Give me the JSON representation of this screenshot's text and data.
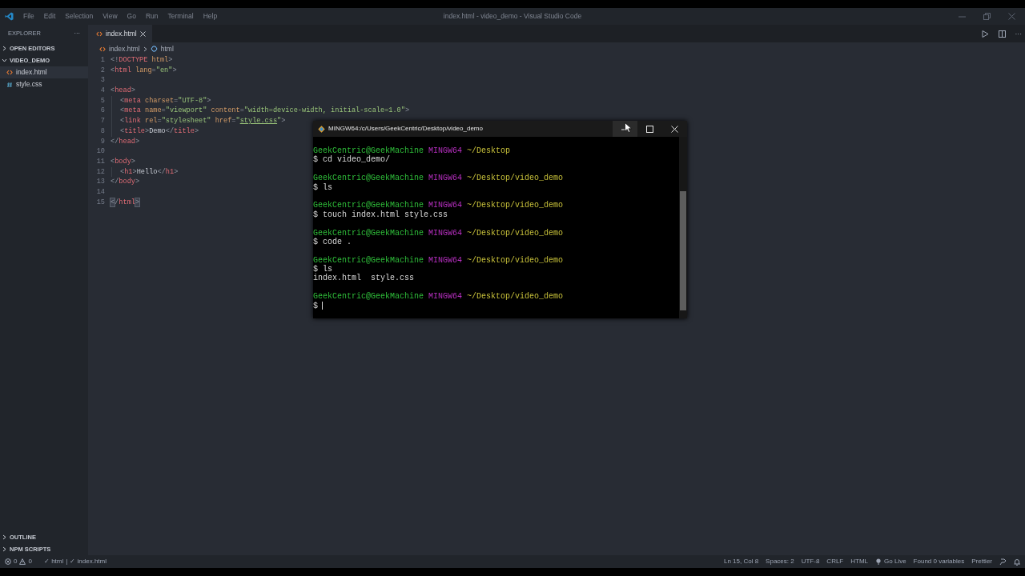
{
  "window": {
    "title": "index.html - video_demo - Visual Studio Code"
  },
  "menu": [
    "File",
    "Edit",
    "Selection",
    "View",
    "Go",
    "Run",
    "Terminal",
    "Help"
  ],
  "sidebar": {
    "title": "EXPLORER",
    "more": "···",
    "sections": [
      {
        "label": "OPEN EDITORS",
        "expanded": false
      },
      {
        "label": "VIDEO_DEMO",
        "expanded": true,
        "files": [
          {
            "name": "index.html",
            "kind": "html",
            "selected": true
          },
          {
            "name": "style.css",
            "kind": "css",
            "selected": false
          }
        ]
      }
    ],
    "bottom_sections": [
      {
        "label": "OUTLINE",
        "expanded": false
      },
      {
        "label": "NPM SCRIPTS",
        "expanded": false
      }
    ]
  },
  "tabs": [
    {
      "label": "index.html",
      "kind": "html",
      "selected": true
    }
  ],
  "breadcrumbs": [
    {
      "label": "index.html",
      "kind": "html"
    },
    {
      "label": "html",
      "kind": "element"
    }
  ],
  "editor": {
    "lines": [
      {
        "number": "1",
        "indented": false,
        "tokens": [
          {
            "kind": "p",
            "text": "<!"
          },
          {
            "kind": "tag",
            "text": "DOCTYPE"
          },
          {
            "kind": "attr",
            "text": " html"
          },
          {
            "kind": "p",
            "text": ">"
          }
        ]
      },
      {
        "number": "2",
        "indented": false,
        "tokens": [
          {
            "kind": "p",
            "text": "<"
          },
          {
            "kind": "tag",
            "text": "html"
          },
          {
            "kind": "attr",
            "text": " lang"
          },
          {
            "kind": "p",
            "text": "="
          },
          {
            "kind": "str",
            "text": "\"en\""
          },
          {
            "kind": "p",
            "text": ">"
          }
        ]
      },
      {
        "number": "3",
        "indented": false
      },
      {
        "number": "4",
        "indented": false,
        "tokens": [
          {
            "kind": "p",
            "text": "<"
          },
          {
            "kind": "tag",
            "text": "head"
          },
          {
            "kind": "p",
            "text": ">"
          }
        ]
      },
      {
        "number": "5",
        "indented": true,
        "tokens": [
          {
            "kind": "p",
            "text": "<"
          },
          {
            "kind": "tag",
            "text": "meta"
          },
          {
            "kind": "attr",
            "text": " charset"
          },
          {
            "kind": "p",
            "text": "="
          },
          {
            "kind": "str",
            "text": "\"UTF-8\""
          },
          {
            "kind": "p",
            "text": ">"
          }
        ]
      },
      {
        "number": "6",
        "indented": true,
        "tokens": [
          {
            "kind": "p",
            "text": "<"
          },
          {
            "kind": "tag",
            "text": "meta"
          },
          {
            "kind": "attr",
            "text": " name"
          },
          {
            "kind": "p",
            "text": "="
          },
          {
            "kind": "str",
            "text": "\"viewport\""
          },
          {
            "kind": "attr",
            "text": " content"
          },
          {
            "kind": "p",
            "text": "="
          },
          {
            "kind": "str",
            "text": "\"width=device-width, initial-scale=1.0\""
          },
          {
            "kind": "p",
            "text": ">"
          }
        ]
      },
      {
        "number": "7",
        "indented": true,
        "tokens": [
          {
            "kind": "p",
            "text": "<"
          },
          {
            "kind": "tag",
            "text": "link"
          },
          {
            "kind": "attr",
            "text": " rel"
          },
          {
            "kind": "p",
            "text": "="
          },
          {
            "kind": "str",
            "text": "\"stylesheet\""
          },
          {
            "kind": "attr",
            "text": " href"
          },
          {
            "kind": "p",
            "text": "="
          },
          {
            "kind": "str",
            "text": "\""
          },
          {
            "kind": "url",
            "text": "style.css"
          },
          {
            "kind": "str",
            "text": "\""
          },
          {
            "kind": "p",
            "text": ">"
          }
        ]
      },
      {
        "number": "8",
        "indented": true,
        "tokens": [
          {
            "kind": "p",
            "text": "<"
          },
          {
            "kind": "tag",
            "text": "title"
          },
          {
            "kind": "p",
            "text": ">"
          },
          {
            "kind": "txt",
            "text": "Demo"
          },
          {
            "kind": "p",
            "text": "</"
          },
          {
            "kind": "tag",
            "text": "title"
          },
          {
            "kind": "p",
            "text": ">"
          }
        ]
      },
      {
        "number": "9",
        "indented": false,
        "tokens": [
          {
            "kind": "p",
            "text": "</"
          },
          {
            "kind": "tag",
            "text": "head"
          },
          {
            "kind": "p",
            "text": ">"
          }
        ]
      },
      {
        "number": "10",
        "indented": false
      },
      {
        "number": "11",
        "indented": false,
        "tokens": [
          {
            "kind": "p",
            "text": "<"
          },
          {
            "kind": "tag",
            "text": "body"
          },
          {
            "kind": "p",
            "text": ">"
          }
        ]
      },
      {
        "number": "12",
        "indented": true,
        "tokens": [
          {
            "kind": "p",
            "text": "<"
          },
          {
            "kind": "tag",
            "text": "h1"
          },
          {
            "kind": "p",
            "text": ">"
          },
          {
            "kind": "txt",
            "text": "Hello"
          },
          {
            "kind": "p",
            "text": "</"
          },
          {
            "kind": "tag",
            "text": "h1"
          },
          {
            "kind": "p",
            "text": ">"
          }
        ]
      },
      {
        "number": "13",
        "indented": false,
        "tokens": [
          {
            "kind": "p",
            "text": "</"
          },
          {
            "kind": "tag",
            "text": "body"
          },
          {
            "kind": "p",
            "text": ">"
          }
        ]
      },
      {
        "number": "14",
        "indented": false
      },
      {
        "number": "15",
        "indented": false,
        "tokens": [
          {
            "kind": "match",
            "text": "<"
          },
          {
            "kind": "p",
            "text": "/"
          },
          {
            "kind": "tag",
            "text": "html"
          },
          {
            "kind": "match",
            "text": ">"
          }
        ]
      }
    ]
  },
  "terminal": {
    "title": "MINGW64:/c/Users/GeekCentric/Desktop/video_demo",
    "lines": [
      {
        "kind": "prompt",
        "user": "GeekCentric@GeekMachine",
        "shell": "MINGW64",
        "path": "~/Desktop"
      },
      {
        "kind": "command",
        "text": "$ cd video_demo/"
      },
      {
        "kind": "prompt",
        "user": "GeekCentric@GeekMachine",
        "shell": "MINGW64",
        "path": "~/Desktop/video_demo"
      },
      {
        "kind": "command",
        "text": "$ ls"
      },
      {
        "kind": "prompt",
        "user": "GeekCentric@GeekMachine",
        "shell": "MINGW64",
        "path": "~/Desktop/video_demo"
      },
      {
        "kind": "command",
        "text": "$ touch index.html style.css"
      },
      {
        "kind": "prompt",
        "user": "GeekCentric@GeekMachine",
        "shell": "MINGW64",
        "path": "~/Desktop/video_demo"
      },
      {
        "kind": "command",
        "text": "$ code ."
      },
      {
        "kind": "prompt",
        "user": "GeekCentric@GeekMachine",
        "shell": "MINGW64",
        "path": "~/Desktop/video_demo"
      },
      {
        "kind": "command",
        "text": "$ ls"
      },
      {
        "kind": "output",
        "text": "index.html  style.css"
      },
      {
        "kind": "prompt",
        "user": "GeekCentric@GeekMachine",
        "shell": "MINGW64",
        "path": "~/Desktop/video_demo"
      },
      {
        "kind": "input",
        "text": "$"
      }
    ]
  },
  "status_bar": {
    "errors": "0",
    "warnings": "0",
    "left": [
      "✓ html",
      "|",
      "✓ index.html"
    ],
    "right": [
      {
        "kind": "text",
        "text": "Ln 15, Col 8"
      },
      {
        "kind": "text",
        "text": "Spaces: 2"
      },
      {
        "kind": "text",
        "text": "UTF-8"
      },
      {
        "kind": "text",
        "text": "CRLF"
      },
      {
        "kind": "text",
        "text": "HTML"
      },
      {
        "kind": "live",
        "text": "Go Live"
      },
      {
        "kind": "text",
        "text": "Found 0 variables"
      },
      {
        "kind": "text",
        "text": "Prettier"
      }
    ]
  }
}
